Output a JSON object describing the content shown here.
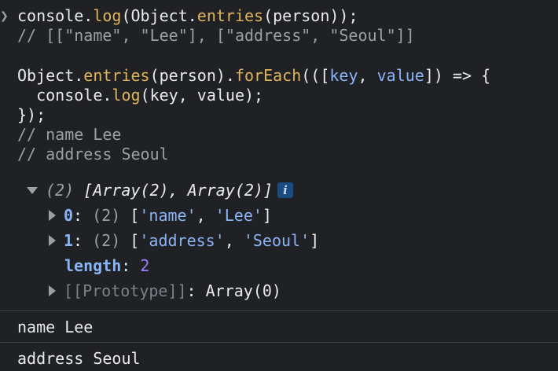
{
  "input": {
    "prompt_icon": "chevron-right-icon",
    "line1": {
      "p1": "console.",
      "p2": "log",
      "p3": "(Object.",
      "p4": "entries",
      "p5": "(person));"
    },
    "line2": "// [[\"name\", \"Lee\"], [\"address\", \"Seoul\"]]",
    "line4": {
      "p1": "Object.",
      "p2": "entries",
      "p3": "(person).",
      "p4": "forEach",
      "p5": "(([",
      "p6": "key",
      "p7": ", ",
      "p8": "value",
      "p9": "]) => {"
    },
    "line5": {
      "p1": "  console.",
      "p2": "log",
      "p3": "(key, value);"
    },
    "line6": "});",
    "line7": "// name Lee",
    "line8": "// address Seoul"
  },
  "output": {
    "root": {
      "count": "(2)",
      "summary": "[Array(2), Array(2)]",
      "info_badge": "i",
      "expanded_icon": "triangle-down-icon"
    },
    "items": [
      {
        "key": "0",
        "colon": ": ",
        "count": "(2)",
        "open": " [",
        "v1": "'name'",
        "sep": ", ",
        "v2": "'Lee'",
        "close": "]",
        "icon": "triangle-right-icon"
      },
      {
        "key": "1",
        "colon": ": ",
        "count": "(2)",
        "open": " [",
        "v1": "'address'",
        "sep": ", ",
        "v2": "'Seoul'",
        "close": "]",
        "icon": "triangle-right-icon"
      }
    ],
    "length": {
      "key": "length",
      "colon": ": ",
      "value": "2"
    },
    "prototype": {
      "key": "[[Prototype]]",
      "colon": ": ",
      "value": "Array(0)",
      "icon": "triangle-right-icon"
    }
  },
  "logs": [
    "name Lee",
    "address Seoul"
  ]
}
